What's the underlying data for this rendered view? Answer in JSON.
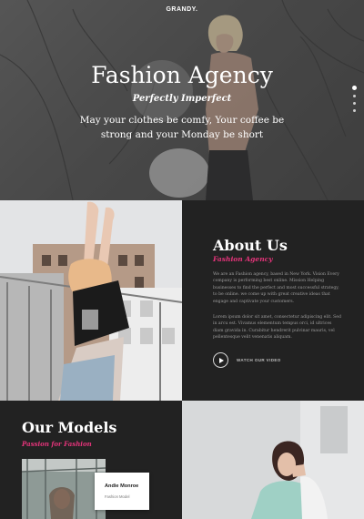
{
  "brand": {
    "logo": "GRANDY."
  },
  "hero": {
    "title": "Fashion Agency",
    "script": "Perfectly Imperfect",
    "text": "May your clothes be comfy, Your coffee be strong and your Monday be short",
    "slides": 4,
    "active_slide": 1
  },
  "about": {
    "title": "About Us",
    "subtitle": "Fashion Agency",
    "paragraph1": "We are an Fashion agency, based in New York. Vision Every company is performing best online. Mission Helping businesses to find the perfect and most successful strategy, to be online. we come up with great creative ideas that engage and captivate your customers.",
    "paragraph2": "Lorem ipsum dolor sit amet, consectetur adipiscing elit. Sed in arcu est. Vivamus elementum tempus orci, id ultrices diam gravida in. Curabitur hendrerit pulvinar mauris, vel pellentesque velit venenatis aliquam.",
    "watch_label": "WATCH OUR VIDEO"
  },
  "models": {
    "title": "Our Models",
    "subtitle": "Passion for Fashion",
    "card": {
      "name": "Andie Monroe",
      "role": "Fashion Model"
    }
  },
  "colors": {
    "accent": "#e4347a",
    "dark_panel": "#222222"
  },
  "icons": {
    "play": "play-icon"
  }
}
